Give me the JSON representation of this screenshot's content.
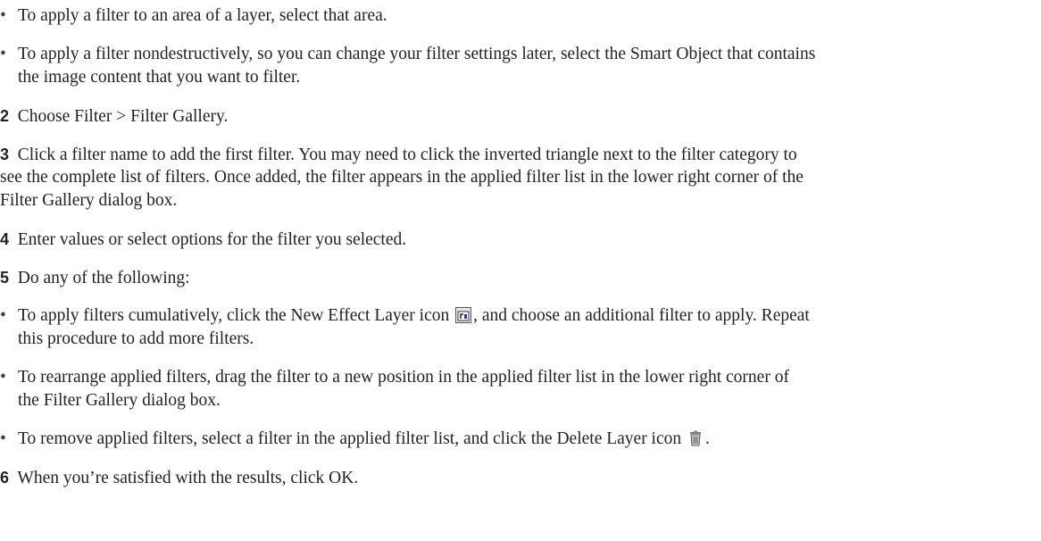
{
  "bullet_char": "•",
  "bullets_top": [
    {
      "lines": [
        "To apply a filter to an area of a layer, select that area."
      ]
    },
    {
      "lines": [
        "To apply a filter nondestructively, so you can change your filter settings later, select the Smart Object that contains",
        "the image content that you want to filter."
      ]
    }
  ],
  "steps": {
    "s2": {
      "num": "2",
      "text": "Choose Filter > Filter Gallery."
    },
    "s3": {
      "num": "3",
      "lines": [
        "Click a filter name to add the first filter. You may need to click the inverted triangle next to the filter category to",
        "see the complete list of filters. Once added, the filter appears in the applied filter list in the lower right corner of the",
        "Filter Gallery dialog box."
      ]
    },
    "s4": {
      "num": "4",
      "text": "Enter values or select options for the filter you selected."
    },
    "s5": {
      "num": "5",
      "text": "Do any of the following:"
    },
    "s6": {
      "num": "6",
      "text": "When you’re satisfied with the results, click OK."
    }
  },
  "bullets_step5": {
    "b1": {
      "line1_before": "To apply filters cumulatively, click the New Effect Layer icon",
      "line1_after": ", and choose an additional filter to apply. Repeat",
      "line2": "this procedure to add more filters.",
      "icon": "new-effect-layer-icon"
    },
    "b2": {
      "lines": [
        "To rearrange applied filters, drag the filter to a new position in the applied filter list in the lower right corner of",
        "the Filter Gallery dialog box."
      ]
    },
    "b3": {
      "before": "To remove applied filters, select a filter in the applied filter list, and click the Delete Layer icon",
      "after": ".",
      "icon": "delete-layer-icon"
    }
  }
}
